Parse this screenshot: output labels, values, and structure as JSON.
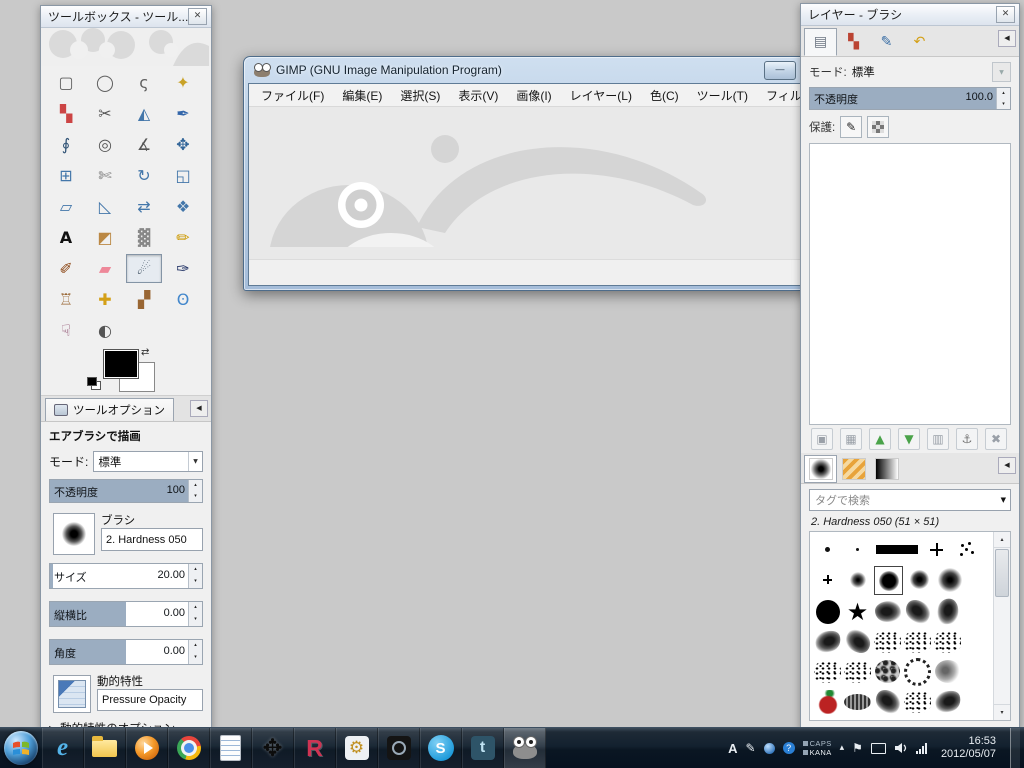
{
  "ui": {
    "close": "✕",
    "minimize": "—",
    "collapse": "◀",
    "dropdown": "▼",
    "spin_up": "▴",
    "spin_down": "▾",
    "expander": "▶",
    "swap": "⇄",
    "star": "★"
  },
  "toolbox": {
    "title": "ツールボックス - ツール...",
    "tools": [
      {
        "name": "rectangle-select",
        "glyph": "▢",
        "color": "#606060"
      },
      {
        "name": "ellipse-select",
        "glyph": "◯",
        "color": "#606060"
      },
      {
        "name": "free-select",
        "glyph": "ς",
        "color": "#606060"
      },
      {
        "name": "fuzzy-select",
        "glyph": "✦",
        "color": "#c9a227"
      },
      {
        "name": "select-by-color",
        "glyph": "▚",
        "color": "#cc4444"
      },
      {
        "name": "scissors-select",
        "glyph": "✂",
        "color": "#555555"
      },
      {
        "name": "foreground-select",
        "glyph": "◭",
        "color": "#4477aa"
      },
      {
        "name": "paths",
        "glyph": "✒",
        "color": "#3366aa"
      },
      {
        "name": "color-picker",
        "glyph": "∮",
        "color": "#335577"
      },
      {
        "name": "zoom",
        "glyph": "◎",
        "color": "#555555"
      },
      {
        "name": "measure",
        "glyph": "∡",
        "color": "#555555"
      },
      {
        "name": "move",
        "glyph": "✥",
        "color": "#336699"
      },
      {
        "name": "align",
        "glyph": "⊞",
        "color": "#4477aa"
      },
      {
        "name": "crop",
        "glyph": "✄",
        "color": "#777777"
      },
      {
        "name": "rotate",
        "glyph": "↻",
        "color": "#4477aa"
      },
      {
        "name": "scale",
        "glyph": "◱",
        "color": "#4477aa"
      },
      {
        "name": "shear",
        "glyph": "▱",
        "color": "#4477aa"
      },
      {
        "name": "perspective",
        "glyph": "◺",
        "color": "#4477aa"
      },
      {
        "name": "flip",
        "glyph": "⇄",
        "color": "#4477aa"
      },
      {
        "name": "cage-transform",
        "glyph": "❖",
        "color": "#4477aa"
      },
      {
        "name": "text",
        "glyph": "A",
        "color": "#111111"
      },
      {
        "name": "bucket-fill",
        "glyph": "◩",
        "color": "#bb8844"
      },
      {
        "name": "blend",
        "glyph": "▓",
        "color": "#888888"
      },
      {
        "name": "pencil",
        "glyph": "✏",
        "color": "#cc9900"
      },
      {
        "name": "paintbrush",
        "glyph": "✐",
        "color": "#8b4513"
      },
      {
        "name": "eraser",
        "glyph": "▰",
        "color": "#ee8899"
      },
      {
        "name": "airbrush",
        "glyph": "☄",
        "color": "#445566",
        "selected": true
      },
      {
        "name": "ink",
        "glyph": "✑",
        "color": "#223366"
      },
      {
        "name": "clone",
        "glyph": "♖",
        "color": "#996633"
      },
      {
        "name": "heal",
        "glyph": "✚",
        "color": "#d4a017"
      },
      {
        "name": "perspective-clone",
        "glyph": "▞",
        "color": "#996633"
      },
      {
        "name": "blur-sharpen",
        "glyph": "ʘ",
        "color": "#4488cc"
      },
      {
        "name": "smudge",
        "glyph": "☟",
        "color": "#884466"
      },
      {
        "name": "dodge-burn",
        "glyph": "◐",
        "color": "#555555"
      }
    ],
    "tool_options": {
      "tab_label": "ツールオプション",
      "heading": "エアブラシで描画",
      "mode_label": "モード:",
      "mode_value": "標準",
      "opacity_label": "不透明度",
      "opacity_value": "100",
      "opacity_fill": "100%",
      "brush_label": "ブラシ",
      "brush_value": "2. Hardness 050",
      "size_label": "サイズ",
      "size_value": "20.00",
      "size_fill": "2%",
      "aspect_label": "縦横比",
      "aspect_value": "0.00",
      "aspect_fill": "50%",
      "angle_label": "角度",
      "angle_value": "0.00",
      "angle_fill": "50%",
      "dynamics_label": "動的特性",
      "dynamics_value": "Pressure Opacity",
      "dynamics_expander": "動的特性のオプション"
    }
  },
  "main_window": {
    "title": "GIMP (GNU Image Manipulation Program)",
    "menus": [
      "ファイル(F)",
      "編集(E)",
      "選択(S)",
      "表示(V)",
      "画像(I)",
      "レイヤー(L)",
      "色(C)",
      "ツール(T)",
      "フィルター"
    ]
  },
  "layers_dialog": {
    "title": "レイヤー - ブラシ",
    "tabs": [
      {
        "name": "layers",
        "glyph": "▤",
        "color": "#6b7480"
      },
      {
        "name": "channels",
        "glyph": "▚",
        "color": "#bb4433"
      },
      {
        "name": "paths",
        "glyph": "✎",
        "color": "#3a6ea5"
      },
      {
        "name": "undo-history",
        "glyph": "↶",
        "color": "#d4a017"
      }
    ],
    "mode_label": "モード:",
    "mode_value": "標準",
    "opacity_label": "不透明度",
    "opacity_value": "100.0",
    "opacity_fill": "100%",
    "lock_label": "保護:",
    "layer_buttons": [
      {
        "name": "new-layer",
        "glyph": "▣",
        "color": "#9aa0a8"
      },
      {
        "name": "new-layer-group",
        "glyph": "▦",
        "color": "#9aa0a8"
      },
      {
        "name": "raise-layer",
        "glyph": "▲",
        "color": "#4aa34a"
      },
      {
        "name": "lower-layer",
        "glyph": "▼",
        "color": "#4aa34a"
      },
      {
        "name": "duplicate-layer",
        "glyph": "▥",
        "color": "#9aa0a8"
      },
      {
        "name": "anchor-layer",
        "glyph": "⚓",
        "color": "#777777"
      },
      {
        "name": "delete-layer",
        "glyph": "✖",
        "color": "#9aa0a8"
      }
    ],
    "brushes": {
      "search_placeholder": "タグで検索",
      "selected_info": "2. Hardness 050 (51 × 51)",
      "items": [
        {
          "type": "dot3"
        },
        {
          "type": "dot2"
        },
        {
          "type": "bar"
        },
        {
          "type": "plus"
        },
        {
          "type": "spark"
        },
        {
          "type": "plus2"
        },
        {
          "type": "soft1"
        },
        {
          "type": "hard050",
          "selected": true
        },
        {
          "type": "soft2"
        },
        {
          "type": "soft3"
        },
        {
          "type": "solid"
        },
        {
          "type": "star"
        },
        {
          "type": "splat1"
        },
        {
          "type": "splat2"
        },
        {
          "type": "splat3"
        },
        {
          "type": "splat4"
        },
        {
          "type": "splat5"
        },
        {
          "type": "scat1"
        },
        {
          "type": "scat2"
        },
        {
          "type": "scat3"
        },
        {
          "type": "scat4"
        },
        {
          "type": "scat5"
        },
        {
          "type": "cells"
        },
        {
          "type": "vine"
        },
        {
          "type": "smoke"
        },
        {
          "type": "pepper"
        },
        {
          "type": "oval"
        },
        {
          "type": "splat2"
        },
        {
          "type": "scat1"
        },
        {
          "type": "splat4"
        },
        {
          "type": "cells"
        },
        {
          "type": "smoke"
        },
        {
          "type": "splat1"
        },
        {
          "type": "scat3"
        }
      ]
    }
  },
  "taskbar": {
    "apps": [
      "internet-explorer",
      "windows-explorer",
      "media-player",
      "chrome",
      "editor",
      "move-tool",
      "r-app",
      "settings",
      "keypad",
      "skype",
      "tweetdeck",
      "gimp"
    ],
    "tray": {
      "ime_mode": "A",
      "caps": "CAPS",
      "kana": "KANA"
    },
    "clock": {
      "time": "16:53",
      "date": "2012/05/07"
    }
  }
}
